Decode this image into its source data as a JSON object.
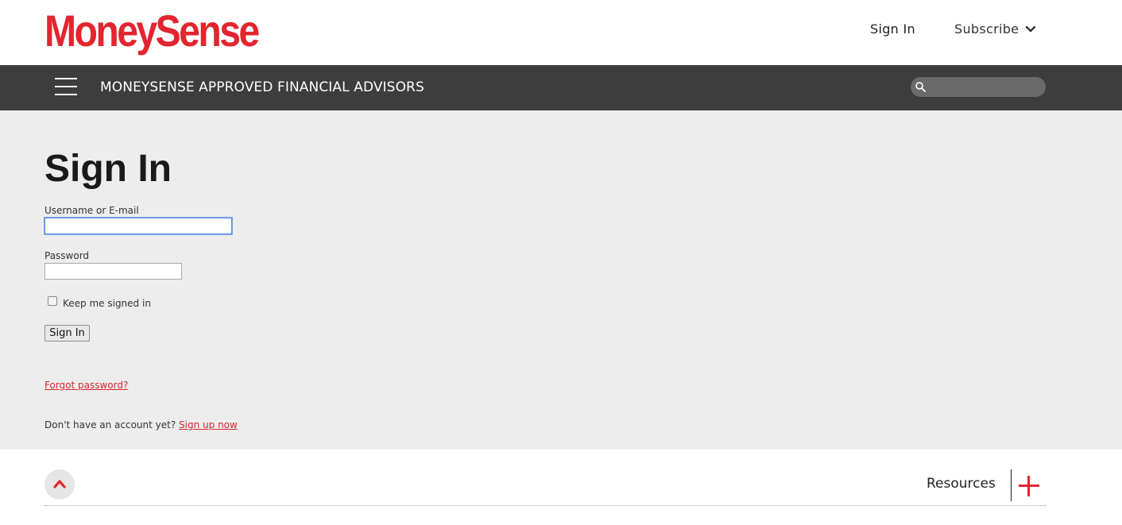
{
  "brand": {
    "logo_text": "MoneySense",
    "accent_color": "#e3252f"
  },
  "header": {
    "sign_in_label": "Sign In",
    "subscribe_label": "Subscribe",
    "subscribe_icon": "chevron-down-icon"
  },
  "navbar": {
    "menu_icon": "hamburger-menu-icon",
    "title": "MONEYSENSE APPROVED FINANCIAL ADVISORS",
    "search_icon": "search-icon",
    "search_value": "",
    "background": "#3d3d3d"
  },
  "form": {
    "title": "Sign In",
    "username_label": "Username or E-mail",
    "username_value": "",
    "password_label": "Password",
    "password_value": "",
    "keep_signed_in_label": "Keep me signed in",
    "keep_signed_in_checked": false,
    "submit_label": "Sign In",
    "forgot_label": "Forgot password?",
    "no_account_text": "Don't have an account yet?",
    "signup_label": "Sign up now",
    "link_color": "#d7262f"
  },
  "footer": {
    "back_to_top_icon": "chevron-up-icon",
    "resources_label": "Resources",
    "expand_icon": "plus-icon"
  }
}
